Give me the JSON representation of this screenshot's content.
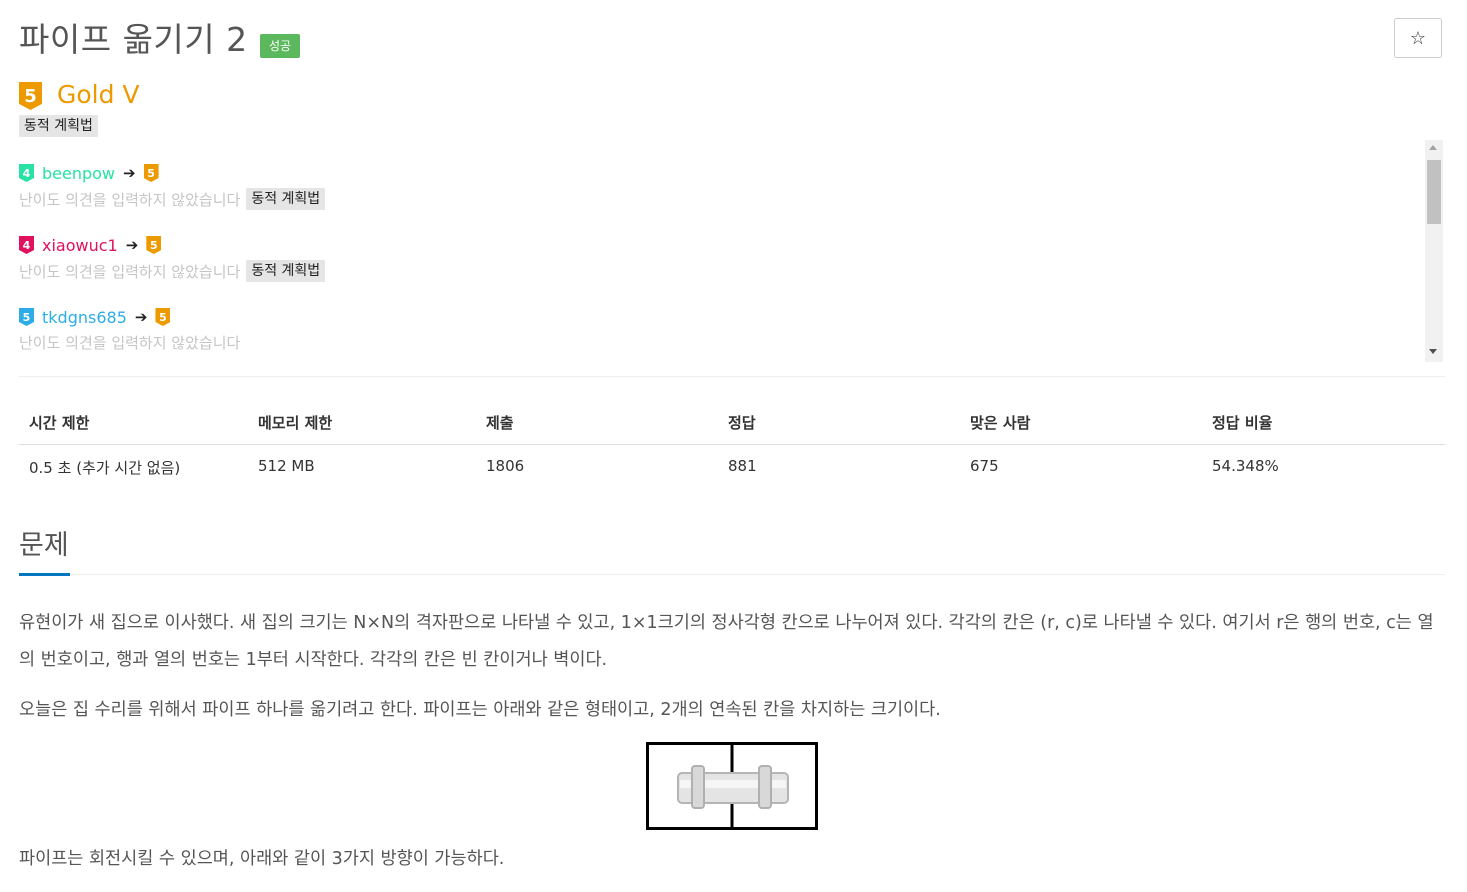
{
  "problem": {
    "title": "파이프 옮기기 2",
    "status_badge": "성공",
    "star_icon": "☆"
  },
  "tier": {
    "level": "5",
    "name": "Gold V",
    "color": "#ec9a00",
    "tags": [
      "동적 계획법"
    ]
  },
  "opinions": [
    {
      "from_level": "4",
      "from_color": "#27e2a4",
      "username": "beenpow",
      "user_color": "#27e2a4",
      "to_level": "5",
      "to_color": "#ec9a00",
      "text": "난이도 의견을 입력하지 않았습니다",
      "tag": "동적 계획법"
    },
    {
      "from_level": "4",
      "from_color": "#e0115f",
      "username": "xiaowuc1",
      "user_color": "#e0115f",
      "to_level": "5",
      "to_color": "#ec9a00",
      "text": "난이도 의견을 입력하지 않았습니다",
      "tag": "동적 계획법"
    },
    {
      "from_level": "5",
      "from_color": "#2dade8",
      "username": "tkdgns685",
      "user_color": "#2dade8",
      "to_level": "5",
      "to_color": "#ec9a00",
      "text": "난이도 의견을 입력하지 않았습니다",
      "tag": ""
    }
  ],
  "arrow": "➔",
  "stats": {
    "headers": [
      "시간 제한",
      "메모리 제한",
      "제출",
      "정답",
      "맞은 사람",
      "정답 비율"
    ],
    "values": [
      "0.5 초 (추가 시간 없음)",
      "512 MB",
      "1806",
      "881",
      "675",
      "54.348%"
    ]
  },
  "section": {
    "title": "문제",
    "paragraphs": [
      "유현이가 새 집으로 이사했다. 새 집의 크기는 N×N의 격자판으로 나타낼 수 있고, 1×1크기의 정사각형 칸으로 나누어져 있다. 각각의 칸은 (r, c)로 나타낼 수 있다. 여기서 r은 행의 번호, c는 열의 번호이고, 행과 열의 번호는 1부터 시작한다. 각각의 칸은 빈 칸이거나 벽이다.",
      "오늘은 집 수리를 위해서 파이프 하나를 옮기려고 한다. 파이프는 아래와 같은 형태이고, 2개의 연속된 칸을 차지하는 크기이다.",
      "파이프는 회전시킬 수 있으며, 아래와 같이 3가지 방향이 가능하다."
    ]
  },
  "colors": {
    "success": "#5cb85c",
    "accent_blue": "#0076c0"
  }
}
